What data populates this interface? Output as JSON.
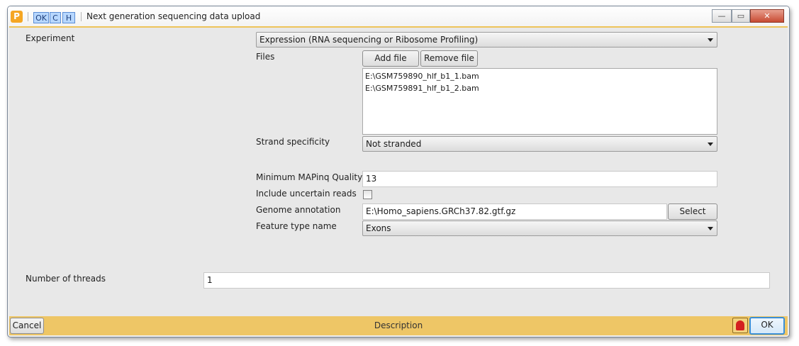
{
  "window": {
    "app_icon_glyph": "P",
    "title": "Next generation sequencing data upload",
    "toolbar": {
      "ok": "OK",
      "c": "C",
      "h": "H"
    },
    "controls": {
      "minimize": "—",
      "maximize": "▭",
      "close": "✕"
    }
  },
  "form": {
    "experiment": {
      "label": "Experiment",
      "value": "Expression (RNA sequencing or Ribosome Profiling)"
    },
    "files": {
      "label": "Files",
      "add_button": "Add file",
      "remove_button": "Remove file",
      "items": [
        "E:\\GSM759890_hlf_b1_1.bam",
        "E:\\GSM759891_hlf_b1_2.bam"
      ]
    },
    "strand": {
      "label": "Strand specificity",
      "value": "Not stranded"
    },
    "mapq": {
      "label": "Minimum MAPinq Quality",
      "value": "13"
    },
    "uncertain": {
      "label": "Include uncertain reads",
      "checked": false
    },
    "genome": {
      "label": "Genome annotation",
      "value": "E:\\Homo_sapiens.GRCh37.82.gtf.gz",
      "select_button": "Select"
    },
    "feature": {
      "label": "Feature type name",
      "value": "Exons"
    },
    "threads": {
      "label": "Number of threads",
      "value": "1"
    }
  },
  "footer": {
    "cancel": "Cancel",
    "description": "Description",
    "ok": "OK"
  },
  "colors": {
    "accent": "#eec666",
    "ok_border": "#3b8fd6"
  }
}
